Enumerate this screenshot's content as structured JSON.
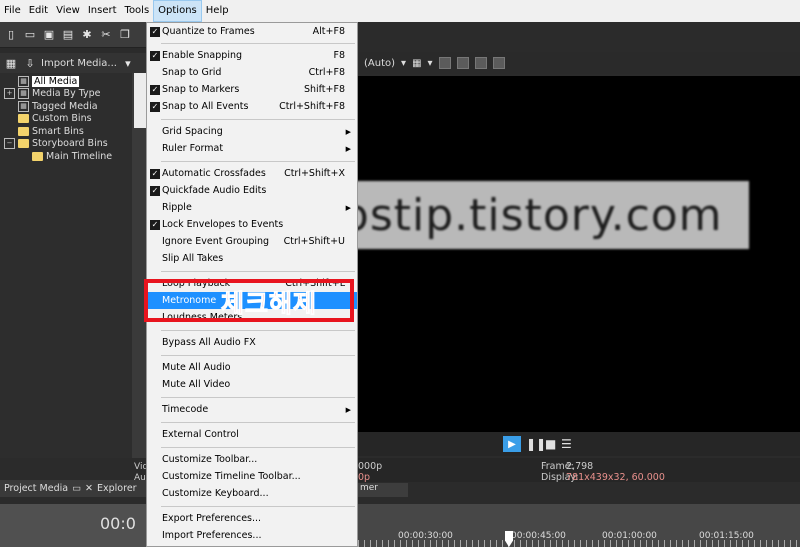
{
  "menubar": [
    "File",
    "Edit",
    "View",
    "Insert",
    "Tools",
    "Options",
    "Help"
  ],
  "explorer": {
    "import_label": "Import Media...",
    "tree": [
      {
        "label": "All Media",
        "selected": true
      },
      {
        "label": "Media By Type"
      },
      {
        "label": "Tagged Media"
      },
      {
        "label": "Custom Bins"
      },
      {
        "label": "Smart Bins"
      },
      {
        "label": "Storyboard Bins"
      },
      {
        "label": "Main Timeline"
      }
    ],
    "side_labels": [
      "Vid",
      "Au"
    ],
    "tabs": {
      "project_media": "Project Media",
      "explorer": "Explorer"
    },
    "timecode": "00:0"
  },
  "preview": {
    "quality": "(Auto)",
    "watermark": "tipstip.tistory.com",
    "frame_label": "Frame:",
    "frame_value": "2,798",
    "display_label": "Display:",
    "display_value": "781x439x32, 60.000",
    "left_info_1": "000p",
    "left_info_2": "0p",
    "subtab": "mer",
    "ruler_labels": [
      "00:00:30:00",
      "00:00:45:00",
      "00:01:00:00",
      "00:01:15:00"
    ]
  },
  "options_menu": {
    "items": [
      {
        "label": "Quantize to Frames",
        "shortcut": "Alt+F8",
        "checked": true
      },
      {
        "label": "Enable Snapping",
        "shortcut": "F8",
        "checked": true
      },
      {
        "label": "Snap to Grid",
        "shortcut": "Ctrl+F8",
        "checked": false
      },
      {
        "label": "Snap to Markers",
        "shortcut": "Shift+F8",
        "checked": true
      },
      {
        "label": "Snap to All Events",
        "shortcut": "Ctrl+Shift+F8",
        "checked": true
      },
      {
        "label": "Grid Spacing",
        "shortcut": "",
        "submenu": true
      },
      {
        "label": "Ruler Format",
        "shortcut": "",
        "submenu": true
      },
      {
        "label": "Automatic Crossfades",
        "shortcut": "Ctrl+Shift+X",
        "checked": true
      },
      {
        "label": "Quickfade Audio Edits",
        "shortcut": "",
        "checked": true
      },
      {
        "label": "Ripple",
        "shortcut": "",
        "submenu": true
      },
      {
        "label": "Lock Envelopes to Events",
        "shortcut": "",
        "checked": true
      },
      {
        "label": "Ignore Event Grouping",
        "shortcut": "Ctrl+Shift+U"
      },
      {
        "label": "Slip All Takes",
        "shortcut": ""
      },
      {
        "label": "Loop Playback",
        "shortcut": "Ctrl+Shift+L"
      },
      {
        "label": "Metronome",
        "shortcut": "",
        "highlighted": true
      },
      {
        "label": "Loudness Meters",
        "shortcut": ""
      },
      {
        "label": "Bypass All Audio FX",
        "shortcut": ""
      },
      {
        "label": "Mute All Audio",
        "shortcut": ""
      },
      {
        "label": "Mute All Video",
        "shortcut": ""
      },
      {
        "label": "Timecode",
        "shortcut": "",
        "submenu": true
      },
      {
        "label": "External Control",
        "shortcut": ""
      },
      {
        "label": "Customize Toolbar...",
        "shortcut": ""
      },
      {
        "label": "Customize Timeline Toolbar...",
        "shortcut": ""
      },
      {
        "label": "Customize Keyboard...",
        "shortcut": ""
      },
      {
        "label": "Export Preferences...",
        "shortcut": ""
      },
      {
        "label": "Import Preferences...",
        "shortcut": ""
      }
    ]
  },
  "annotation": "체크해제",
  "colors": {
    "highlight": "#1e90ff",
    "annotation": "#e8141e",
    "play": "#3a9ee8"
  }
}
